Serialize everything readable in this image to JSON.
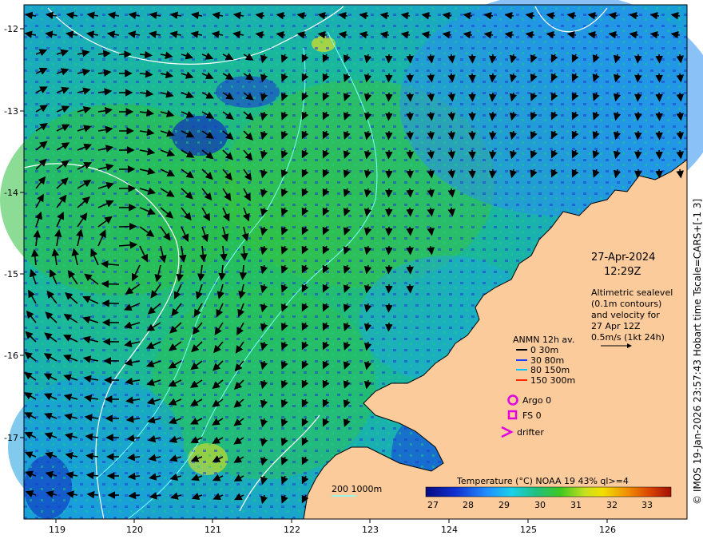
{
  "map": {
    "date_label": "27-Apr-2024",
    "time_label": "12:29Z",
    "altimetry_note": [
      "Altimetric sealevel",
      "(0.1m contours)",
      "and velocity for",
      "27 Apr 12Z",
      "0.5m/s (1kt 24h)"
    ],
    "lat_ticks": [
      "-12",
      "-13",
      "-14",
      "-15",
      "-16",
      "-17"
    ],
    "lon_ticks": [
      "119",
      "120",
      "121",
      "122",
      "123",
      "124",
      "125",
      "126"
    ],
    "anmn_legend": {
      "title": "ANMN 12h av.",
      "items": [
        {
          "label": "0 30m",
          "color": "#000000"
        },
        {
          "label": "30 80m",
          "color": "#1f3fff"
        },
        {
          "label": "80 150m",
          "color": "#00c8ff"
        },
        {
          "label": "150 300m",
          "color": "#ff2a00"
        }
      ]
    },
    "argo_label": "Argo 0",
    "fs_label": "FS 0",
    "drifter_label": "drifter",
    "depth_contours_label": "200  1000m",
    "colorbar": {
      "title": "Temperature (°C) NOAA 19 43% ql>=4",
      "ticks": [
        "27",
        "28",
        "29",
        "30",
        "31",
        "32",
        "33"
      ]
    },
    "credit": "© IMOS 19-Jan-2026 23:57:43 Hobart time Tscale=CARS+[-1 3]",
    "colors": {
      "land": "#fccb9c",
      "ocean_mid": "#22c0a0",
      "argo": "#e000e0",
      "contour": "#7fffff"
    }
  }
}
